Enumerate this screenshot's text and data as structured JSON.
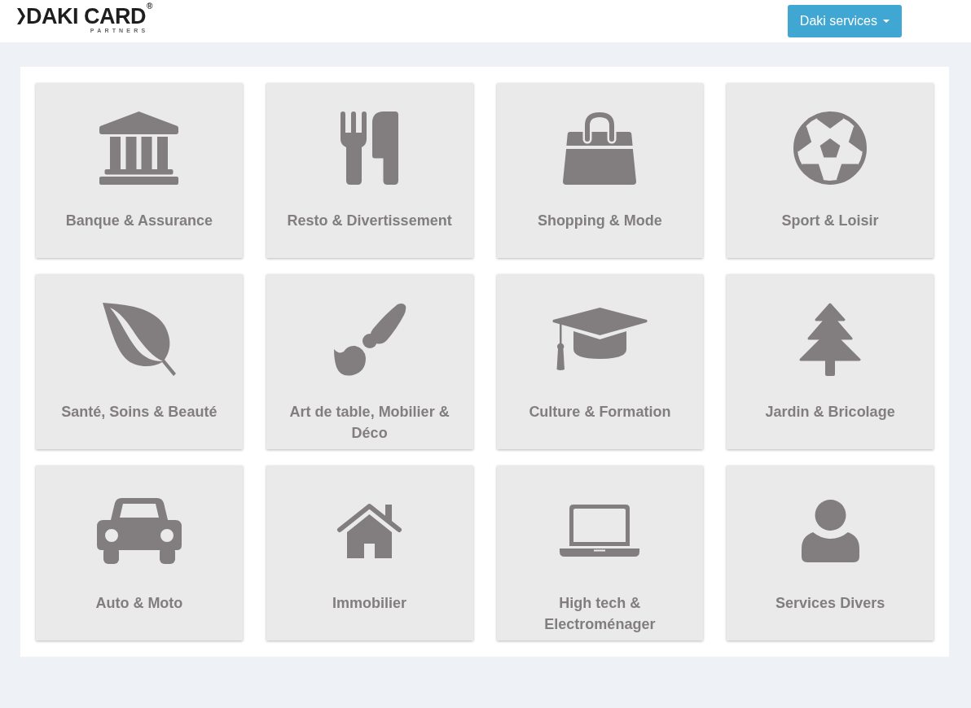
{
  "header": {
    "logo": {
      "brand": "DAKI CARD",
      "registered_mark": "®",
      "tagline": "PARTNERS"
    },
    "services_button": {
      "label": "Daki services"
    }
  },
  "categories": [
    {
      "label": "Banque & Assurance"
    },
    {
      "label": "Resto & Divertissement"
    },
    {
      "label": "Shopping & Mode"
    },
    {
      "label": "Sport & Loisir"
    },
    {
      "label": "Santé, Soins & Beauté"
    },
    {
      "label": "Art de table, Mobilier & Déco"
    },
    {
      "label": "Culture & Formation"
    },
    {
      "label": "Jardin & Bricolage"
    },
    {
      "label": "Auto & Moto"
    },
    {
      "label": "Immobilier"
    },
    {
      "label": "High tech & Electroménager"
    },
    {
      "label": "Services Divers"
    }
  ]
}
